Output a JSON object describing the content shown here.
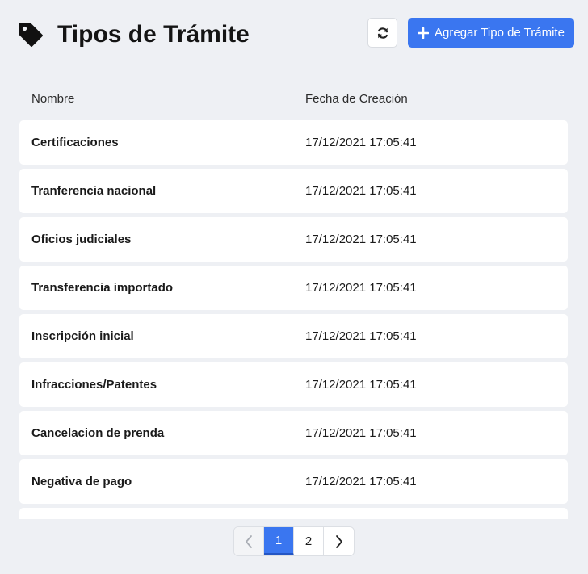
{
  "header": {
    "title": "Tipos de Trámite",
    "title_icon": "tag-icon",
    "refresh_icon": "refresh-icon",
    "add_label": "Agregar Tipo de Trámite",
    "add_icon": "plus-icon"
  },
  "table": {
    "columns": [
      "Nombre",
      "Fecha de Creación"
    ],
    "rows": [
      {
        "name": "Certificaciones",
        "date": "17/12/2021 17:05:41"
      },
      {
        "name": "Tranferencia nacional",
        "date": "17/12/2021 17:05:41"
      },
      {
        "name": "Oficios judiciales",
        "date": "17/12/2021 17:05:41"
      },
      {
        "name": "Transferencia importado",
        "date": "17/12/2021 17:05:41"
      },
      {
        "name": "Inscripción inicial",
        "date": "17/12/2021 17:05:41"
      },
      {
        "name": "Infracciones/Patentes",
        "date": "17/12/2021 17:05:41"
      },
      {
        "name": "Cancelacion de prenda",
        "date": "17/12/2021 17:05:41"
      },
      {
        "name": "Negativa de pago",
        "date": "17/12/2021 17:05:41"
      },
      {
        "name": "",
        "date": ""
      }
    ]
  },
  "pagination": {
    "prev_icon": "chevron-left-icon",
    "next_icon": "chevron-right-icon",
    "pages": [
      "1",
      "2"
    ],
    "active_page": "1"
  },
  "colors": {
    "background": "#eef0f4",
    "accent": "#3a76f0",
    "row_background": "#ffffff"
  }
}
